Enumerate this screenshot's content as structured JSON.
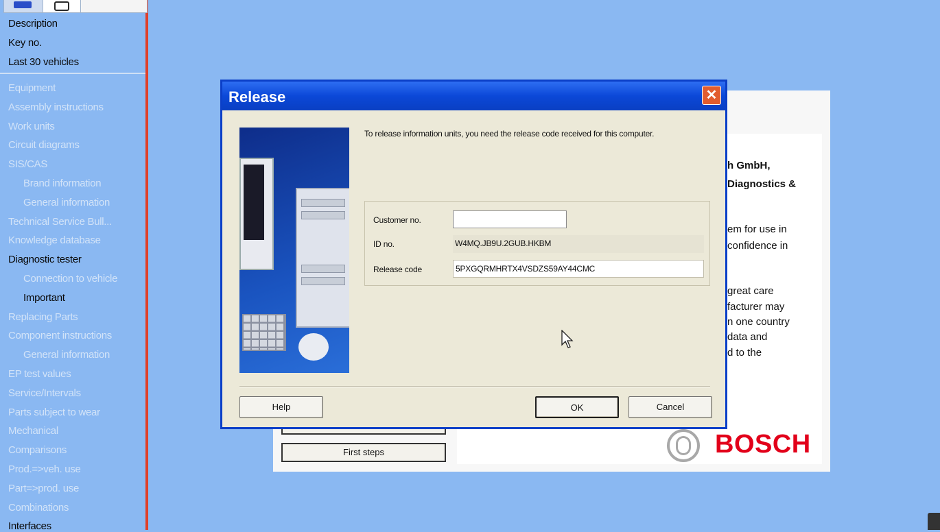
{
  "sidebar": {
    "top_items": [
      "Description",
      "Key no.",
      "Last 30 vehicles"
    ],
    "items": [
      {
        "label": "Equipment",
        "dim": true,
        "indent": false
      },
      {
        "label": "Assembly instructions",
        "dim": true,
        "indent": false
      },
      {
        "label": "Work units",
        "dim": true,
        "indent": false
      },
      {
        "label": "Circuit diagrams",
        "dim": true,
        "indent": false
      },
      {
        "label": "SIS/CAS",
        "dim": true,
        "indent": false
      },
      {
        "label": "Brand information",
        "dim": true,
        "indent": true
      },
      {
        "label": "General information",
        "dim": true,
        "indent": true
      },
      {
        "label": "Technical Service Bull...",
        "dim": true,
        "indent": false
      },
      {
        "label": "Knowledge database",
        "dim": true,
        "indent": false
      },
      {
        "label": "Diagnostic tester",
        "dim": false,
        "indent": false
      },
      {
        "label": "Connection to vehicle",
        "dim": true,
        "indent": true
      },
      {
        "label": "Important",
        "dim": false,
        "indent": true
      },
      {
        "label": "Replacing Parts",
        "dim": true,
        "indent": false
      },
      {
        "label": "Component instructions",
        "dim": true,
        "indent": false
      },
      {
        "label": "General information",
        "dim": true,
        "indent": true
      },
      {
        "label": "EP test values",
        "dim": true,
        "indent": false
      },
      {
        "label": "Service/Intervals",
        "dim": true,
        "indent": false
      },
      {
        "label": "Parts subject to wear",
        "dim": true,
        "indent": false
      },
      {
        "label": "Mechanical",
        "dim": true,
        "indent": false
      },
      {
        "label": "Comparisons",
        "dim": true,
        "indent": false
      },
      {
        "label": "Prod.=>veh. use",
        "dim": true,
        "indent": false
      },
      {
        "label": "Part=>prod. use",
        "dim": true,
        "indent": false
      },
      {
        "label": "Combinations",
        "dim": true,
        "indent": false
      },
      {
        "label": "Interfaces",
        "dim": false,
        "indent": false
      }
    ]
  },
  "background_window": {
    "text_lines": [
      {
        "text": "h GmbH,",
        "bold": true
      },
      {
        "text": "Diagnostics &",
        "bold": true
      },
      {
        "text": "em for use in",
        "bold": false
      },
      {
        "text": "confidence in",
        "bold": false
      },
      {
        "text": "great care",
        "bold": false
      },
      {
        "text": "facturer may",
        "bold": false
      },
      {
        "text": "n one country",
        "bold": false
      },
      {
        "text": "data and",
        "bold": false
      },
      {
        "text": "d to the",
        "bold": false
      }
    ],
    "first_steps_label": "First steps",
    "brand": "BOSCH",
    "brand_color": "#e2001a"
  },
  "dialog": {
    "title": "Release",
    "close_glyph": "✕",
    "instructions": "To release information units, you need the release code received for this computer.",
    "fields": {
      "customer_label": "Customer no.",
      "customer_value": "",
      "id_label": "ID no.",
      "id_value": "W4MQ.JB9U.2GUB.HKBM",
      "release_label": "Release code",
      "release_value": "5PXGQRMHRTX4VSDZS59AY44CMC"
    },
    "buttons": {
      "help": "Help",
      "ok": "OK",
      "cancel": "Cancel"
    }
  },
  "colors": {
    "desktop": "#8ab8f2",
    "titlebar": "#0b48d8",
    "dialog_body": "#ece9d8",
    "sidebar_border": "#e0402a"
  }
}
